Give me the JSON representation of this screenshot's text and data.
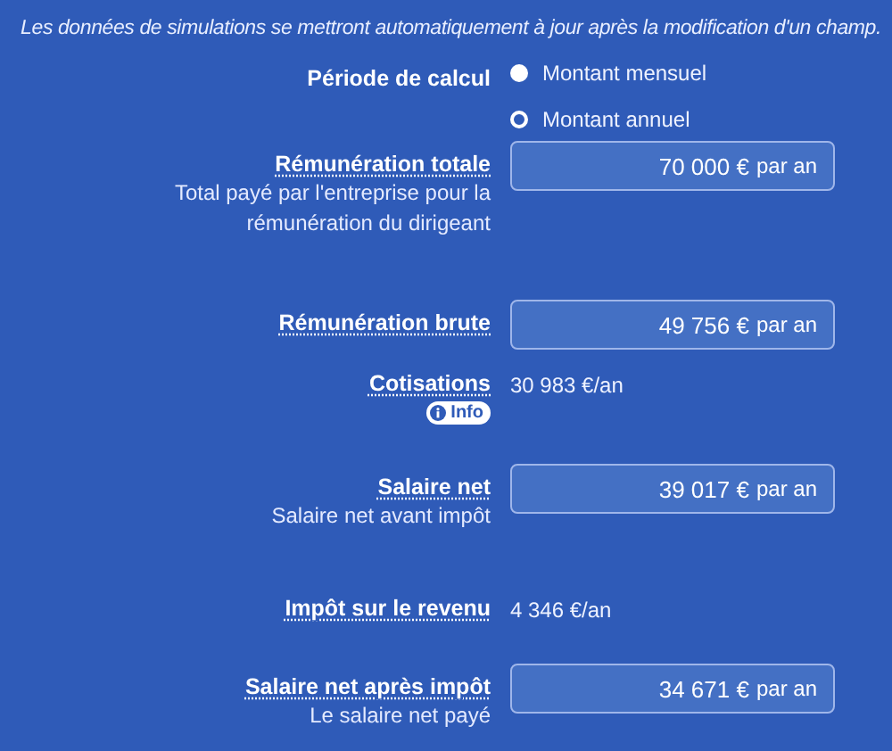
{
  "notice": "Les données de simulations se mettront automatiquement à jour après la modification d'un champ.",
  "period": {
    "label": "Période de calcul",
    "options": [
      {
        "label": "Montant mensuel",
        "selected": false
      },
      {
        "label": "Montant annuel",
        "selected": true
      }
    ]
  },
  "rows": [
    {
      "kind": "input",
      "label": "Rémunération totale",
      "description": "Total payé par l'entreprise pour la rémunération du dirigeant",
      "value": "70 000 €",
      "unit": "par an"
    },
    {
      "kind": "input",
      "label": "Rémunération brute",
      "value": "49 756 €",
      "unit": "par an"
    },
    {
      "kind": "value",
      "label": "Cotisations",
      "badge": "Info",
      "value": "30 983 €/an"
    },
    {
      "kind": "input",
      "label": "Salaire net",
      "description": "Salaire net avant impôt",
      "value": "39 017 €",
      "unit": "par an"
    },
    {
      "kind": "value",
      "label": "Impôt sur le revenu",
      "value": "4 346 €/an"
    },
    {
      "kind": "input",
      "label": "Salaire net après impôt",
      "description": "Le salaire net payé",
      "value": "34 671 €",
      "unit": "par an"
    }
  ]
}
